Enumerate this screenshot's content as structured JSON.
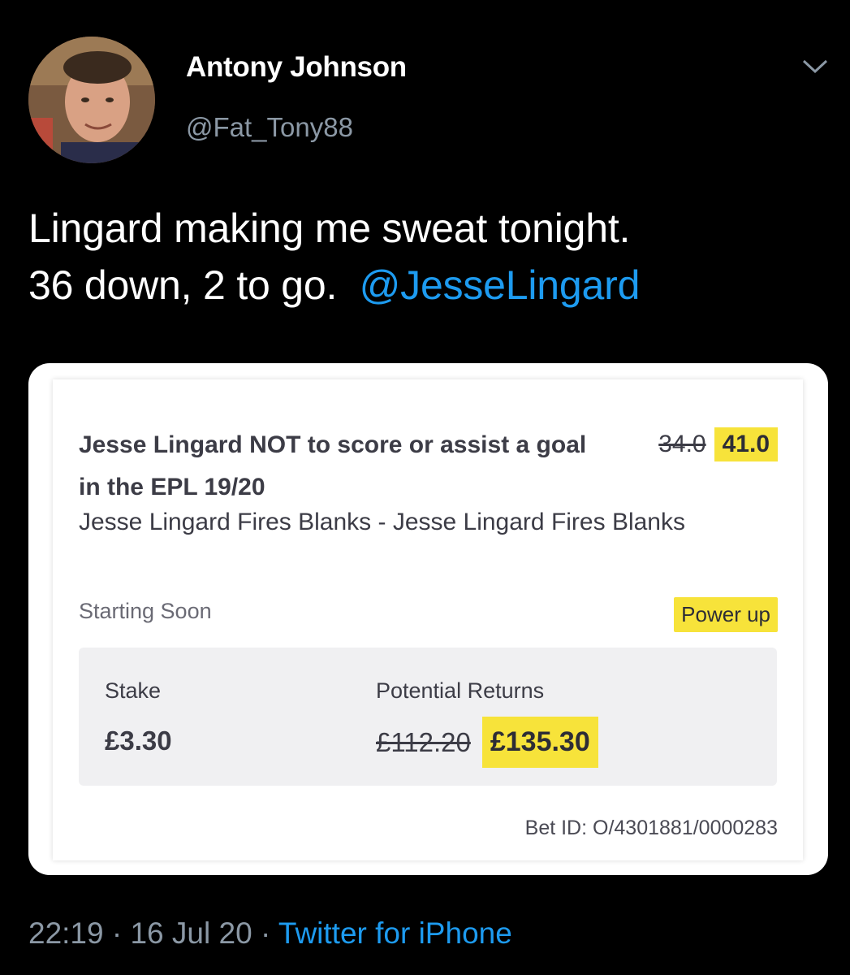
{
  "tweet": {
    "author": {
      "display_name": "Antony Johnson",
      "handle": "@Fat_Tony88",
      "avatar_icon": "user-avatar"
    },
    "more_icon": "chevron-down-icon",
    "text_line1": "Lingard making me sweat tonight.",
    "text_line2_prefix": "36 down, 2 to go.",
    "mention": "@JesseLingard",
    "timestamp_time": "22:19",
    "separator": "·",
    "timestamp_date": "16 Jul 20",
    "source": "Twitter for iPhone"
  },
  "bet_slip": {
    "title": "Jesse Lingard NOT to score or assist a goal in the EPL 19/20",
    "odds_old": "34.0",
    "odds_new": "41.0",
    "subtitle": "Jesse Lingard Fires Blanks - Jesse Lingard Fires Blanks",
    "status": "Starting Soon",
    "badge": "Power up",
    "stake_label": "Stake",
    "stake_value": "£3.30",
    "returns_label": "Potential Returns",
    "returns_old": "£112.20",
    "returns_new": "£135.30",
    "bet_id": "Bet ID: O/4301881/0000283"
  },
  "colors": {
    "background": "#000000",
    "mention": "#1d9bf0",
    "muted": "#8b98a5",
    "highlight": "#f7e33a"
  }
}
